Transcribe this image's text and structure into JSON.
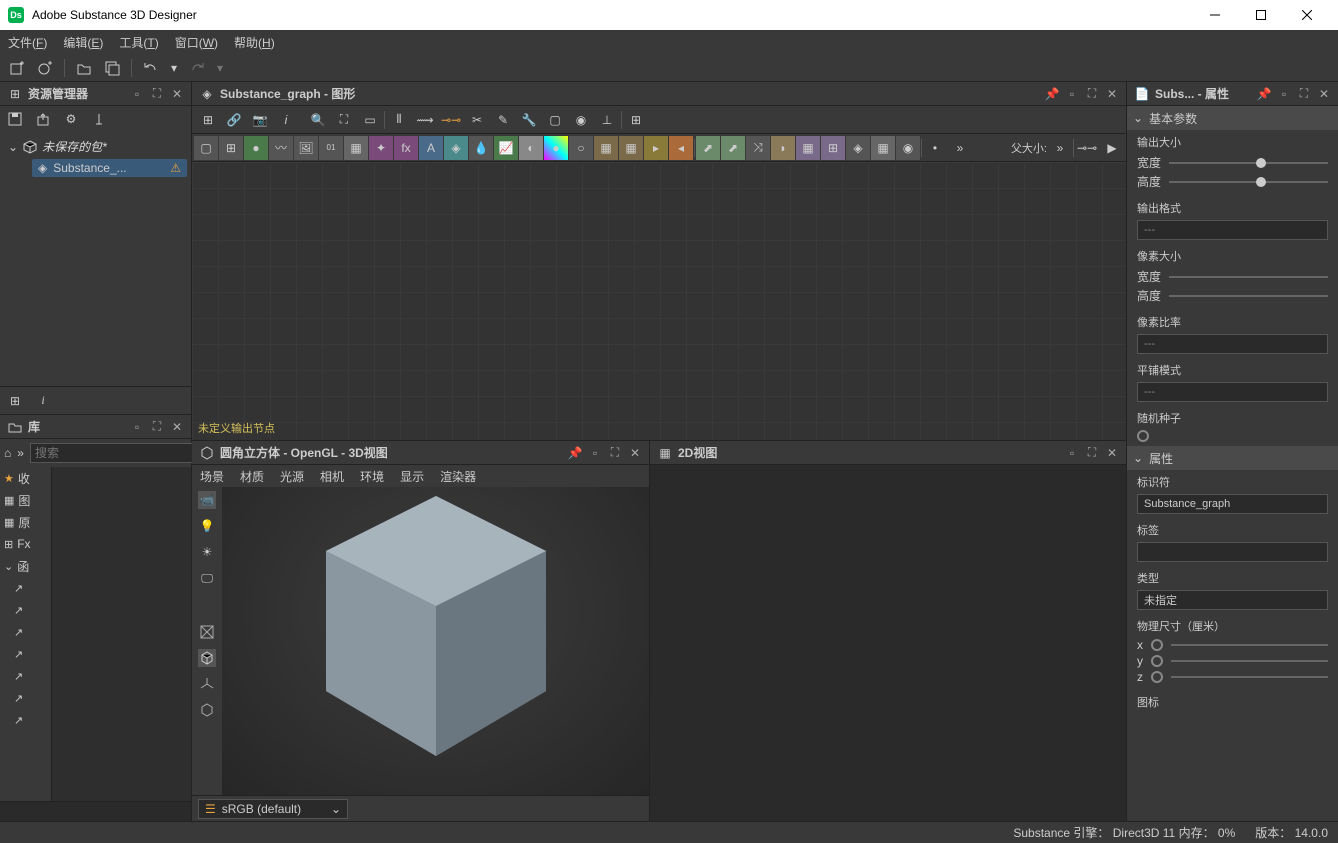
{
  "title": "Adobe Substance 3D Designer",
  "menu": {
    "file": "文件(F)",
    "edit": "编辑(E)",
    "tools": "工具(T)",
    "window": "窗口(W)",
    "help": "帮助(H)"
  },
  "explorer": {
    "title": "资源管理器",
    "package": "未保存的包*",
    "graph": "Substance_..."
  },
  "library": {
    "title": "库",
    "search_ph": "搜索",
    "cats": [
      "收",
      "图",
      "原",
      "Fx",
      "函"
    ]
  },
  "graph": {
    "title": "Substance_graph - 图形",
    "parent": "父大小:",
    "warn": "未定义输出节点"
  },
  "view3d": {
    "title": "圆角立方体 - OpenGL - 3D视图",
    "menu": [
      "场景",
      "材质",
      "光源",
      "相机",
      "环境",
      "显示",
      "渲染器"
    ],
    "colorspace": "sRGB (default)"
  },
  "view2d": {
    "title": "2D视图"
  },
  "props": {
    "title": "Subs... - 属性",
    "sect_basic": "基本参数",
    "output_size": "输出大小",
    "width": "宽度",
    "height": "高度",
    "output_format": "输出格式",
    "dash": "---",
    "pixel_size": "像素大小",
    "pixel_ratio": "像素比率",
    "tiling": "平铺模式",
    "seed": "随机种子",
    "sect_attr": "属性",
    "identifier": "标识符",
    "identifier_val": "Substance_graph",
    "label": "标签",
    "type": "类型",
    "type_val": "未指定",
    "physical": "物理尺寸（厘米）",
    "icon": "图标"
  },
  "status": {
    "engine": "Substance 引擎：",
    "renderer": "Direct3D 11",
    "mem": "内存：",
    "mem_val": "0%",
    "ver": "版本：",
    "ver_val": "14.0.0"
  }
}
